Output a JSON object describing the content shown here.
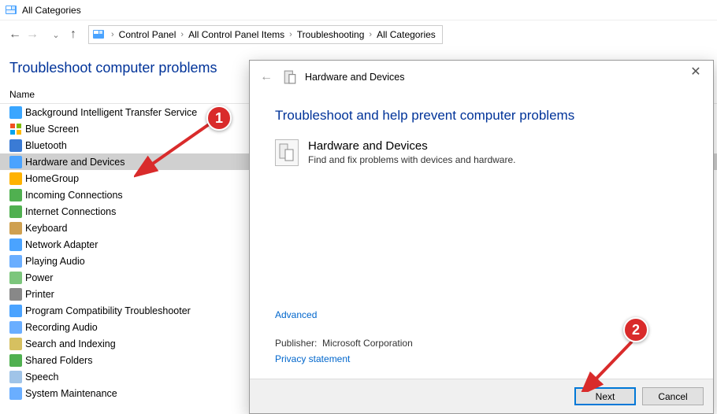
{
  "window": {
    "title": "All Categories"
  },
  "breadcrumb": {
    "items": [
      "Control Panel",
      "All Control Panel Items",
      "Troubleshooting",
      "All Categories"
    ]
  },
  "page": {
    "heading": "Troubleshoot computer problems"
  },
  "columns": {
    "name": "Name"
  },
  "troubleshooters": {
    "items": [
      {
        "label": "Background Intelligent Transfer Service",
        "icon_bg": "#3aa6ff",
        "name": "bits"
      },
      {
        "label": "Blue Screen",
        "icon_bg": "#2d7fd6",
        "name": "blue-screen",
        "four": true
      },
      {
        "label": "Bluetooth",
        "icon_bg": "#3a7bd5",
        "name": "bluetooth"
      },
      {
        "label": "Hardware and Devices",
        "icon_bg": "#4aa3ff",
        "name": "hardware-devices",
        "selected": true
      },
      {
        "label": "HomeGroup",
        "icon_bg": "#ffb200",
        "name": "homegroup"
      },
      {
        "label": "Incoming Connections",
        "icon_bg": "#50b050",
        "name": "incoming-connections"
      },
      {
        "label": "Internet Connections",
        "icon_bg": "#50b050",
        "name": "internet-connections"
      },
      {
        "label": "Keyboard",
        "icon_bg": "#cfa050",
        "name": "keyboard"
      },
      {
        "label": "Network Adapter",
        "icon_bg": "#4aa3ff",
        "name": "network-adapter"
      },
      {
        "label": "Playing Audio",
        "icon_bg": "#6aaeff",
        "name": "playing-audio"
      },
      {
        "label": "Power",
        "icon_bg": "#7cc67c",
        "name": "power"
      },
      {
        "label": "Printer",
        "icon_bg": "#888888",
        "name": "printer"
      },
      {
        "label": "Program Compatibility Troubleshooter",
        "icon_bg": "#4aa3ff",
        "name": "program-compat"
      },
      {
        "label": "Recording Audio",
        "icon_bg": "#6aaeff",
        "name": "recording-audio"
      },
      {
        "label": "Search and Indexing",
        "icon_bg": "#d6c060",
        "name": "search-indexing"
      },
      {
        "label": "Shared Folders",
        "icon_bg": "#50b050",
        "name": "shared-folders"
      },
      {
        "label": "Speech",
        "icon_bg": "#a0c4e8",
        "name": "speech"
      },
      {
        "label": "System Maintenance",
        "icon_bg": "#6aaeff",
        "name": "system-maintenance"
      }
    ]
  },
  "wizard": {
    "header_title": "Hardware and Devices",
    "heading": "Troubleshoot and help prevent computer problems",
    "block_title": "Hardware and Devices",
    "block_sub": "Find and fix problems with devices and hardware.",
    "advanced_link": "Advanced",
    "publisher_label": "Publisher:",
    "publisher_value": "Microsoft Corporation",
    "privacy_link": "Privacy statement",
    "next_label": "Next",
    "cancel_label": "Cancel"
  },
  "annotations": {
    "badge1": "1",
    "badge2": "2"
  }
}
